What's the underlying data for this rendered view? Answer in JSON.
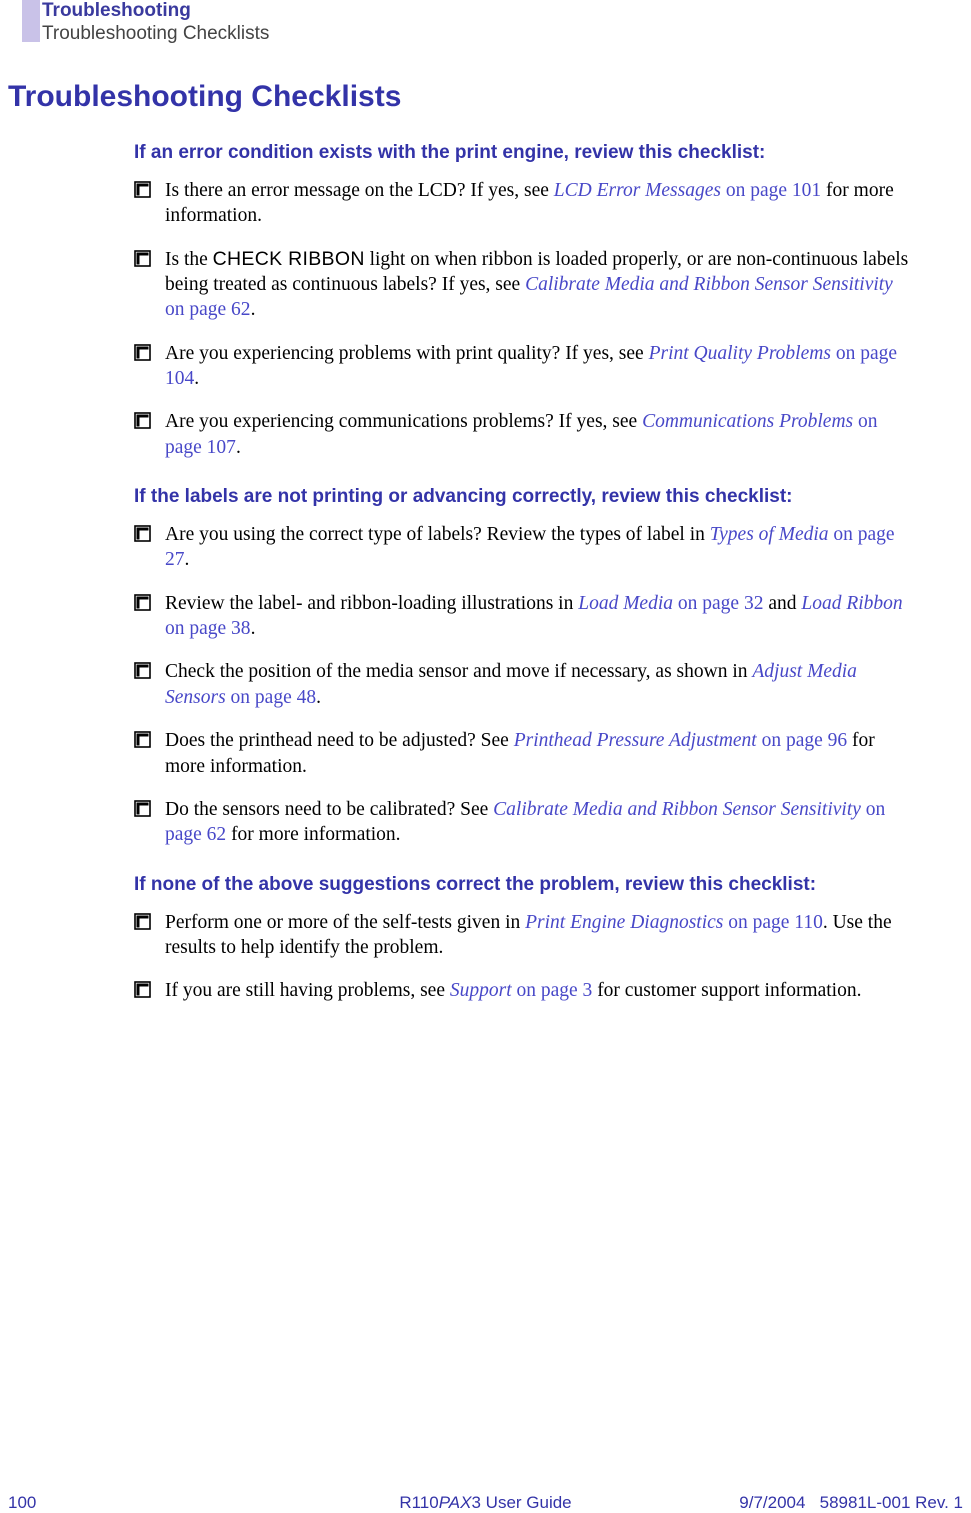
{
  "header": {
    "chapter": "Troubleshooting",
    "section": "Troubleshooting Checklists"
  },
  "title": "Troubleshooting Checklists",
  "groups": [
    {
      "prompt": "If an error condition exists with the print engine, review this checklist:",
      "items": [
        {
          "pre": "Is there an error message on the LCD? If yes, see ",
          "link_italic": "LCD Error Messages",
          "link_page": " on page 101",
          "post": " for more information."
        },
        {
          "pre": "Is the ",
          "sans": "CHECK RIBBON",
          "mid": " light on when ribbon is loaded properly, or are non-continuous labels being treated as continuous labels? If yes, see ",
          "link_italic": "Calibrate Media and Ribbon Sensor Sensitivity",
          "link_page": " on page 62",
          "post": "."
        },
        {
          "pre": "Are you experiencing problems with print quality? If yes, see ",
          "link_italic": "Print Quality Problems",
          "link_page": " on page 104",
          "post": "."
        },
        {
          "pre": "Are you experiencing communications problems? If yes, see ",
          "link_italic": "Communications Problems",
          "link_page": " on page 107",
          "post": "."
        }
      ]
    },
    {
      "prompt": "If the labels are not printing or advancing correctly, review this checklist:",
      "items": [
        {
          "pre": "Are you using the correct type of labels? Review the types of label in ",
          "link_italic": "Types of Media",
          "link_page": " on page 27",
          "post": "."
        },
        {
          "pre": "Review the label- and ribbon-loading illustrations in ",
          "link_italic": "Load Media",
          "link_page": " on page 32",
          "mid2": " and ",
          "link2_italic": "Load Ribbon",
          "link2_page": " on page 38",
          "post": "."
        },
        {
          "pre": "Check the position of the media sensor and move if necessary, as shown in ",
          "link_italic": "Adjust Media Sensors",
          "link_page": " on page 48",
          "post": "."
        },
        {
          "pre": "Does the printhead need to be adjusted? See ",
          "link_italic": "Printhead Pressure Adjustment",
          "link_page": " on page 96",
          "post": " for more information."
        },
        {
          "pre": "Do the sensors need to be calibrated? See ",
          "link_italic": "Calibrate Media and Ribbon Sensor Sensitivity",
          "link_page": " on page 62",
          "post": " for more information."
        }
      ]
    },
    {
      "prompt": "If none of the above suggestions correct the problem, review this checklist:",
      "items": [
        {
          "pre": "Perform one or more of the self-tests given in ",
          "link_italic": "Print Engine Diagnostics",
          "link_page": " on page 110",
          "post": ". Use the results to help identify the problem."
        },
        {
          "pre": "If you are still having problems, see ",
          "link_italic": "Support",
          "link_page": " on page 3",
          "post": " for customer support information."
        }
      ]
    }
  ],
  "footer": {
    "page": "100",
    "guide_prefix": "R110",
    "guide_italic": "PAX",
    "guide_suffix": "3 User Guide",
    "date": "9/7/2004",
    "doc": "58981L-001 Rev. 1"
  }
}
